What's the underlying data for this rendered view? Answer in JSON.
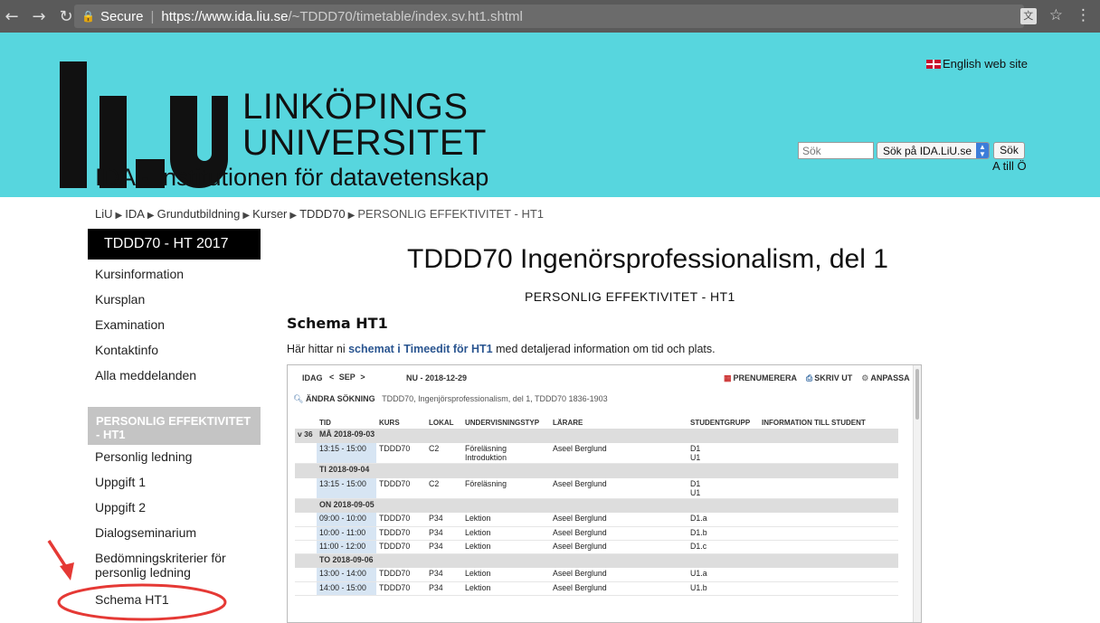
{
  "browser": {
    "secure_label": "Secure",
    "url_host": "https://www.ida.liu.se",
    "url_path": "/~TDDD70/timetable/index.sv.ht1.shtml"
  },
  "header": {
    "logo_mark": "li.u",
    "logo_line1": "LINKÖPINGS",
    "logo_line2": "UNIVERSITET",
    "department": "IDA - Institutionen för datavetenskap",
    "english_link": "English web site",
    "search_placeholder": "Sök",
    "search_scope": "Sök på IDA.LiU.se",
    "search_button": "Sök",
    "a_to_o": "A till Ö"
  },
  "breadcrumb": [
    "LiU",
    "IDA",
    "Grundutbildning",
    "Kurser",
    "TDDD70",
    "PERSONLIG EFFEKTIVITET - HT1"
  ],
  "sidebar": {
    "course": "TDDD70 - HT 2017",
    "links": [
      "Kursinformation",
      "Kursplan",
      "Examination",
      "Kontaktinfo",
      "Alla meddelanden"
    ],
    "section": "PERSONLIG EFFEKTIVITET - HT1",
    "section_links": [
      "Personlig ledning",
      "Uppgift 1",
      "Uppgift 2",
      "Dialogseminarium",
      "Bedömningskriterier för personlig ledning",
      "Schema HT1"
    ]
  },
  "main": {
    "title": "TDDD70 Ingenörsprofessionalism, del 1",
    "subtitle": "PERSONLIG EFFEKTIVITET - HT1",
    "heading": "Schema HT1",
    "intro_before": "Här hittar ni ",
    "intro_link": "schemat i Timeedit för HT1",
    "intro_after": " med detaljerad information om tid och plats."
  },
  "timetable": {
    "today": "IDAG",
    "prev": "<",
    "month": "SEP",
    "next": ">",
    "now_date": "NU - 2018-12-29",
    "subscribe": "PRENUMERERA",
    "print": "SKRIV UT",
    "customize": "ANPASSA",
    "change_search": "ÄNDRA SÖKNING",
    "search_desc": "TDDD70, Ingenjörsprofessionalism, del 1, TDDD70 1836-1903",
    "columns": [
      "TID",
      "KURS",
      "LOKAL",
      "UNDERVISNINGSTYP",
      "LÄRARE",
      "STUDENTGRUPP",
      "INFORMATION TILL STUDENT"
    ],
    "week": "v 36",
    "days": [
      {
        "label": "MÅ 2018-09-03",
        "rows": [
          {
            "time": "13:15 - 15:00",
            "course": "TDDD70",
            "room": "C2",
            "type": "Föreläsning",
            "type2": "Introduktion",
            "teacher": "Aseel Berglund",
            "group": "D1",
            "group2": "U1"
          }
        ]
      },
      {
        "label": "TI 2018-09-04",
        "rows": [
          {
            "time": "13:15 - 15:00",
            "course": "TDDD70",
            "room": "C2",
            "type": "Föreläsning",
            "type2": "",
            "teacher": "Aseel Berglund",
            "group": "D1",
            "group2": "U1"
          }
        ]
      },
      {
        "label": "ON 2018-09-05",
        "rows": [
          {
            "time": "09:00 - 10:00",
            "course": "TDDD70",
            "room": "P34",
            "type": "Lektion",
            "type2": "",
            "teacher": "Aseel Berglund",
            "group": "D1.a",
            "group2": ""
          },
          {
            "time": "10:00 - 11:00",
            "course": "TDDD70",
            "room": "P34",
            "type": "Lektion",
            "type2": "",
            "teacher": "Aseel Berglund",
            "group": "D1.b",
            "group2": ""
          },
          {
            "time": "11:00 - 12:00",
            "course": "TDDD70",
            "room": "P34",
            "type": "Lektion",
            "type2": "",
            "teacher": "Aseel Berglund",
            "group": "D1.c",
            "group2": ""
          }
        ]
      },
      {
        "label": "TO 2018-09-06",
        "rows": [
          {
            "time": "13:00 - 14:00",
            "course": "TDDD70",
            "room": "P34",
            "type": "Lektion",
            "type2": "",
            "teacher": "Aseel Berglund",
            "group": "U1.a",
            "group2": ""
          },
          {
            "time": "14:00 - 15:00",
            "course": "TDDD70",
            "room": "P34",
            "type": "Lektion",
            "type2": "",
            "teacher": "Aseel Berglund",
            "group": "U1.b",
            "group2": ""
          }
        ]
      }
    ]
  },
  "colors": {
    "banner": "#57d6de",
    "sidebar_dark": "#000000",
    "section_gray": "#c4c4c4",
    "link_blue": "#2a5590",
    "annotation_red": "#e53935"
  }
}
